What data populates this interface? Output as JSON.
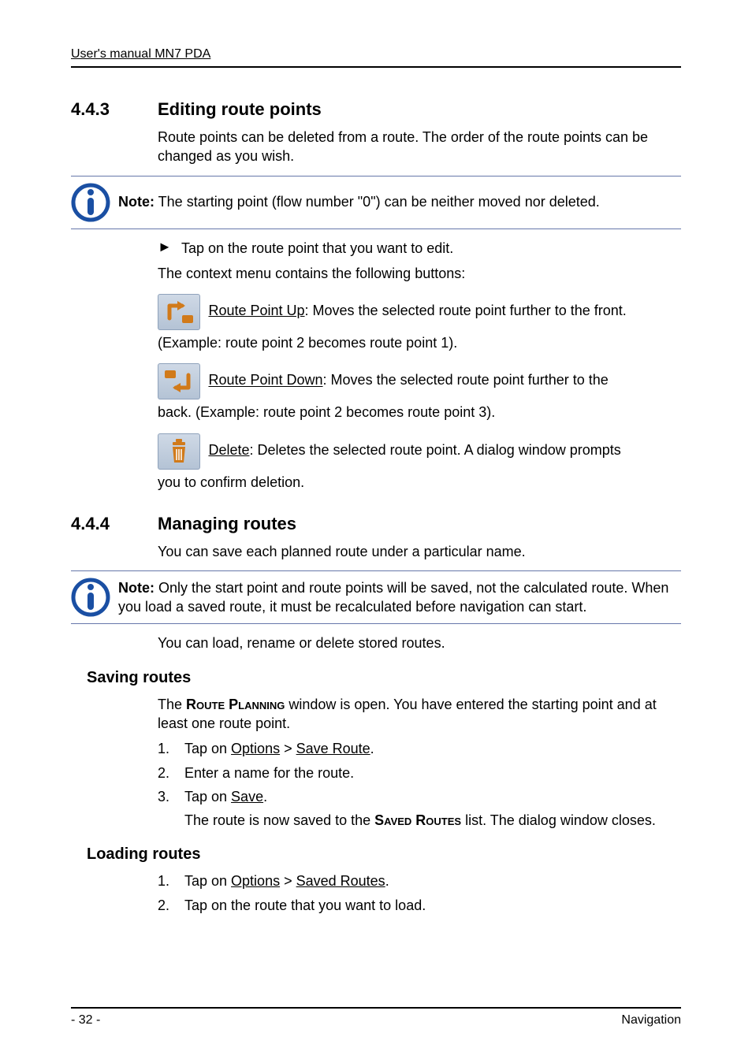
{
  "header": {
    "title": "User's manual MN7 PDA"
  },
  "section443": {
    "number": "4.4.3",
    "title": "Editing route points",
    "intro": "Route points can be deleted from a route. The order of the route points can be changed as you wish.",
    "note_prefix": "Note:",
    "note_body": " The starting point (flow number \"0\") can be neither moved nor deleted.",
    "bullet_text": "Tap on the route point that you want to edit.",
    "context_line": "The context menu contains the following buttons:",
    "up_label": "Route Point Up",
    "up_tail": ": Moves the selected route point further to the front.",
    "up_line2": "(Example: route point 2 becomes route point 1).",
    "down_label": "Route Point Down",
    "down_tail": ": Moves the selected route point further to the",
    "down_line2": "back. (Example: route point 2 becomes route point 3).",
    "delete_label": "Delete",
    "delete_tail": ": Deletes the selected route point. A dialog window prompts",
    "delete_line2": "you to confirm deletion."
  },
  "section444": {
    "number": "4.4.4",
    "title": "Managing routes",
    "intro": "You can save each planned route under a particular name.",
    "note_prefix": "Note:",
    "note_body": " Only the start point and route points will be saved, not the calculated route. When you load a saved route, it must be recalculated before navigation can start.",
    "after_note": "You can load, rename or delete stored routes."
  },
  "saving": {
    "title": "Saving routes",
    "intro_pre": "The ",
    "intro_sc": "Route Planning",
    "intro_post": " window is open. You have entered the starting point and at least one route point.",
    "step1_pre": "Tap on ",
    "step1_u1": "Options",
    "step1_mid": " > ",
    "step1_u2": "Save Route",
    "step1_post": ".",
    "step2": "Enter a name for the route.",
    "step3_pre": "Tap on ",
    "step3_u": "Save",
    "step3_post": ".",
    "result_pre": "The route is now saved to the ",
    "result_sc": "Saved Routes",
    "result_post": " list. The dialog window closes."
  },
  "loading": {
    "title": "Loading routes",
    "step1_pre": "Tap on ",
    "step1_u1": "Options",
    "step1_mid": " > ",
    "step1_u2": "Saved Routes",
    "step1_post": ".",
    "step2": "Tap on the route that you want to load."
  },
  "footer": {
    "page": "- 32 -",
    "section": "Navigation"
  },
  "numbers": {
    "n1": "1.",
    "n2": "2.",
    "n3": "3."
  },
  "glyphs": {
    "bullet": "►"
  }
}
